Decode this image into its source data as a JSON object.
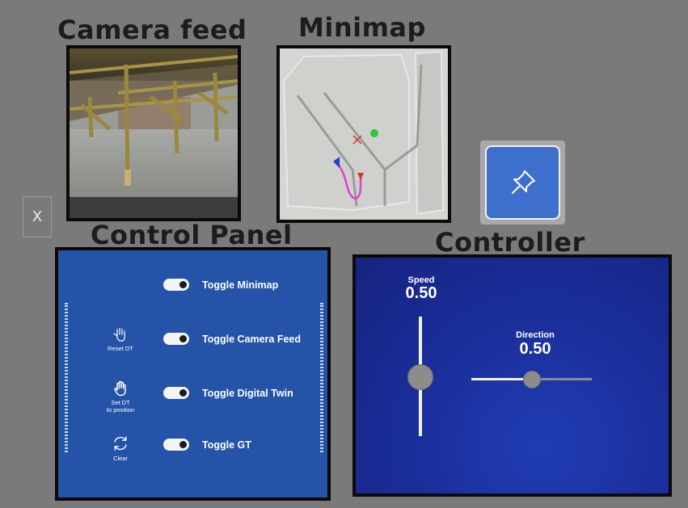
{
  "titles": {
    "camera_feed": "Camera feed",
    "minimap": "Minimap",
    "control_panel": "Control Panel",
    "controller": "Controller"
  },
  "close_button": {
    "label": "X"
  },
  "pin_button": {
    "icon": "pin-icon"
  },
  "control_panel": {
    "toggles": [
      {
        "label": "Toggle Minimap",
        "on": true
      },
      {
        "label": "Toggle Camera Feed",
        "on": true
      },
      {
        "label": "Toggle Digital Twin",
        "on": true
      },
      {
        "label": "Toggle GT",
        "on": true
      }
    ],
    "side_buttons": [
      {
        "label": "Reset DT",
        "icon": "hand-icon"
      },
      {
        "label_line1": "Set DT",
        "label_line2": "to position",
        "icon": "palm-icon"
      },
      {
        "label": "Clear",
        "icon": "refresh-icon"
      }
    ]
  },
  "controller": {
    "speed": {
      "label": "Speed",
      "value": "0.50",
      "level": 0.5
    },
    "direction": {
      "label": "Direction",
      "value": "0.50",
      "level": 0.5
    }
  },
  "colors": {
    "background": "#7a7a7a",
    "panel_blue": "#2453a8",
    "controller_blue": "#1a2c98",
    "pin_blue": "#3f6fcd",
    "path_magenta": "#e040d0",
    "marker_red": "#e03030",
    "marker_blue": "#2040d0",
    "marker_green": "#40d040"
  }
}
